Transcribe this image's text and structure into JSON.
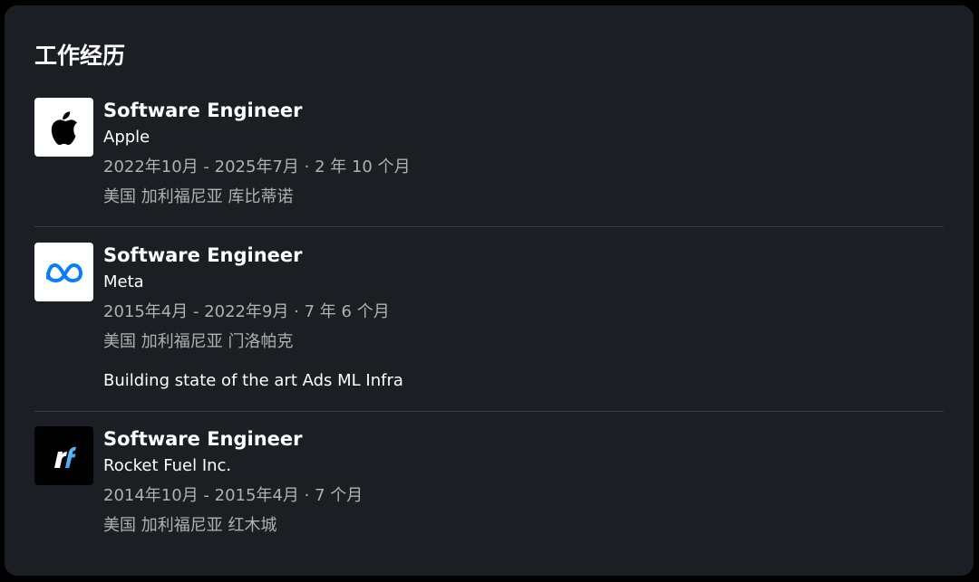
{
  "section": {
    "title": "工作经历"
  },
  "experience": [
    {
      "title": "Software Engineer",
      "company": "Apple",
      "dates": "2022年10月 - 2025年7月 · 2 年 10 个月",
      "location": "美国 加利福尼亚 库比蒂诺",
      "logo_icon": "apple-logo-icon"
    },
    {
      "title": "Software Engineer",
      "company": "Meta",
      "dates": "2015年4月 - 2022年9月 · 7 年 6 个月",
      "location": "美国 加利福尼亚 门洛帕克",
      "description": "Building state of the art Ads ML Infra",
      "logo_icon": "meta-logo-icon"
    },
    {
      "title": "Software Engineer",
      "company": "Rocket Fuel Inc.",
      "dates": "2014年10月 - 2015年4月 · 7 个月",
      "location": "美国 加利福尼亚 红木城",
      "logo_icon": "rocket-fuel-logo-icon"
    }
  ],
  "colors": {
    "background": "#000000",
    "card": "#1b1f23",
    "primary_text": "#ffffff",
    "secondary_text": "#b0b0b0",
    "divider": "#3b3f44",
    "meta_blue": "#0a7cff",
    "rocket_fuel_blue": "#3fa9f5"
  }
}
